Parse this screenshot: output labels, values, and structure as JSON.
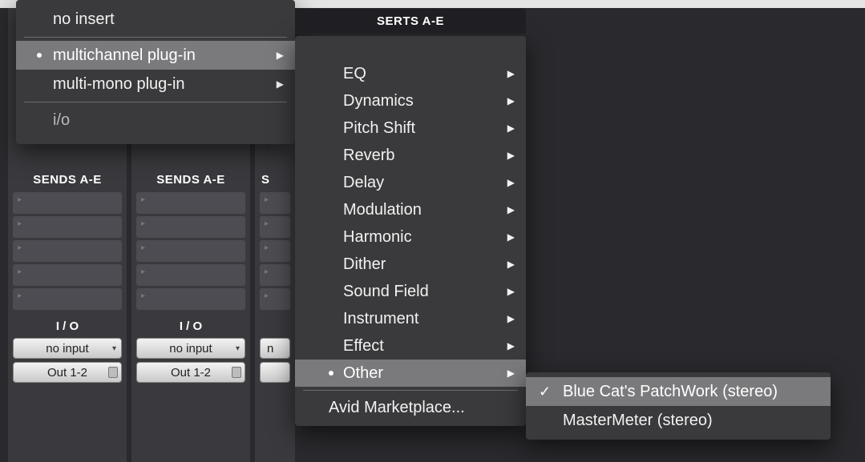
{
  "topbar": {
    "session_icon": "session-icon"
  },
  "inserts_header": "INSERTS A-E",
  "menu1": {
    "no_insert": "no insert",
    "multichannel": "multichannel plug-in",
    "multimono": "multi-mono plug-in",
    "io": "i/o"
  },
  "menu2": {
    "header": "SERTS A-E",
    "items": {
      "eq": "EQ",
      "dynamics": "Dynamics",
      "pitch_shift": "Pitch Shift",
      "reverb": "Reverb",
      "delay": "Delay",
      "modulation": "Modulation",
      "harmonic": "Harmonic",
      "dither": "Dither",
      "sound_field": "Sound Field",
      "instrument": "Instrument",
      "effect": "Effect",
      "other": "Other",
      "avid_marketplace": "Avid Marketplace..."
    }
  },
  "menu3": {
    "bluecat": "Blue Cat's PatchWork (stereo)",
    "mastermeter": "MasterMeter (stereo)"
  },
  "strips": {
    "sends_label": "SENDS A-E",
    "io_label": "I / O",
    "no_input": "no input",
    "out": "Out 1-2",
    "n": "n"
  }
}
